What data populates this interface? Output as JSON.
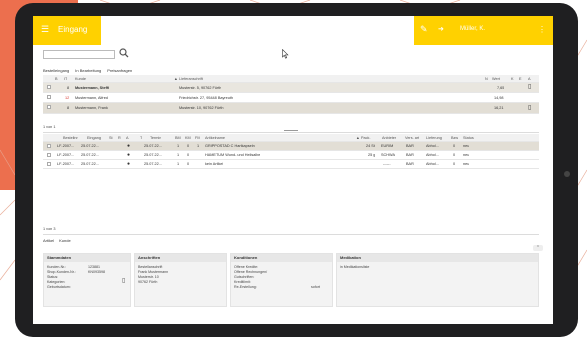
{
  "header": {
    "title": "Eingang",
    "user": "Müller, K."
  },
  "tabs": [
    "Bestelleingang",
    "In Bearbeitung",
    "Preisanfragen"
  ],
  "orders": {
    "columns": [
      "B",
      "IT",
      "Kunde",
      "Lieferanschrift",
      "N",
      "Wert",
      "K",
      "E",
      "A"
    ],
    "rows": [
      {
        "id": "8",
        "kunde": "Mustermann, Steffi",
        "adresse": "Musterstr. 5, 90762 Fürth",
        "wert": "7,65",
        "highlight": false
      },
      {
        "id": "12",
        "kunde": "Mustermann, Alfred",
        "adresse": "Friedrichstr. 27, 95448 Bayreuth",
        "wert": "14,98",
        "highlight": true
      },
      {
        "id": "8",
        "kunde": "Mustermann, Frank",
        "adresse": "Musterstr. 10, 90762 Fürth",
        "wert": "16,21",
        "highlight": false
      }
    ]
  },
  "orders_count": "1 von 1",
  "lines": {
    "columns": [
      "Bestellnr",
      "Eingang",
      "St",
      "R",
      "A",
      "T",
      "Termin",
      "BM",
      "KM",
      "FM",
      "Artikelname",
      "Pack.",
      "Anbieter",
      "Vers. art",
      "Lieferung",
      "Bzw",
      "Status"
    ],
    "rows": [
      {
        "nr": "LF-2007...",
        "eingang": "25.07.22...",
        "termin": "25.07.22...",
        "bm": "1",
        "km": "0",
        "fm": "1",
        "artikel": "GRIPPOSTAD C Hartkapseln",
        "pack": "24 St",
        "anbieter": "EURIM",
        "vers": "BAR",
        "lief": "Abhol...",
        "bzw": "0",
        "status": "neu"
      },
      {
        "nr": "LF-2007...",
        "eingang": "25.07.22...",
        "termin": "25.07.22...",
        "bm": "1",
        "km": "0",
        "fm": "",
        "artikel": "HAMETUM Wund- und Heilsalbe",
        "pack": "25 g",
        "anbieter": "SCHWA",
        "vers": "BAR",
        "lief": "Abhol...",
        "bzw": "0",
        "status": "neu"
      },
      {
        "nr": "LF-2007...",
        "eingang": "25.07.22...",
        "termin": "25.07.22...",
        "bm": "1",
        "km": "0",
        "fm": "",
        "artikel": "kein Artikel",
        "pack": "",
        "anbieter": "------",
        "vers": "BAR",
        "lief": "Abhol...",
        "bzw": "0",
        "status": "neu"
      }
    ]
  },
  "lines_count": "1 von 3",
  "detail_tabs": [
    "Artikel",
    "Kunde"
  ],
  "panels": {
    "stammdaten": {
      "title": "Stammdaten",
      "kundennr_label": "Kunden-Nr.:",
      "kundennr": "123881",
      "shop_label": "Shop-Kunden-Nr.:",
      "shop": "KN093598",
      "lines": [
        "Status:",
        "Kategorien:",
        "Geburtsdatum:"
      ]
    },
    "anschriften": {
      "title": "Anschriften",
      "lines": [
        "Bestellanschrift",
        "Frank Mustermann",
        "Musterstr. 10",
        "90762 Fürth"
      ]
    },
    "konditionen": {
      "title": "Konditionen",
      "lines": [
        "Offene Kredite:",
        "Offene Rechnungen/",
        "Gutschriften:",
        "Kreditlimit:",
        "Re-Erstellung:"
      ],
      "re_value": "sofort"
    },
    "medikation": {
      "title": "Medikation",
      "lines": [
        "in Medikationsliste"
      ]
    }
  }
}
